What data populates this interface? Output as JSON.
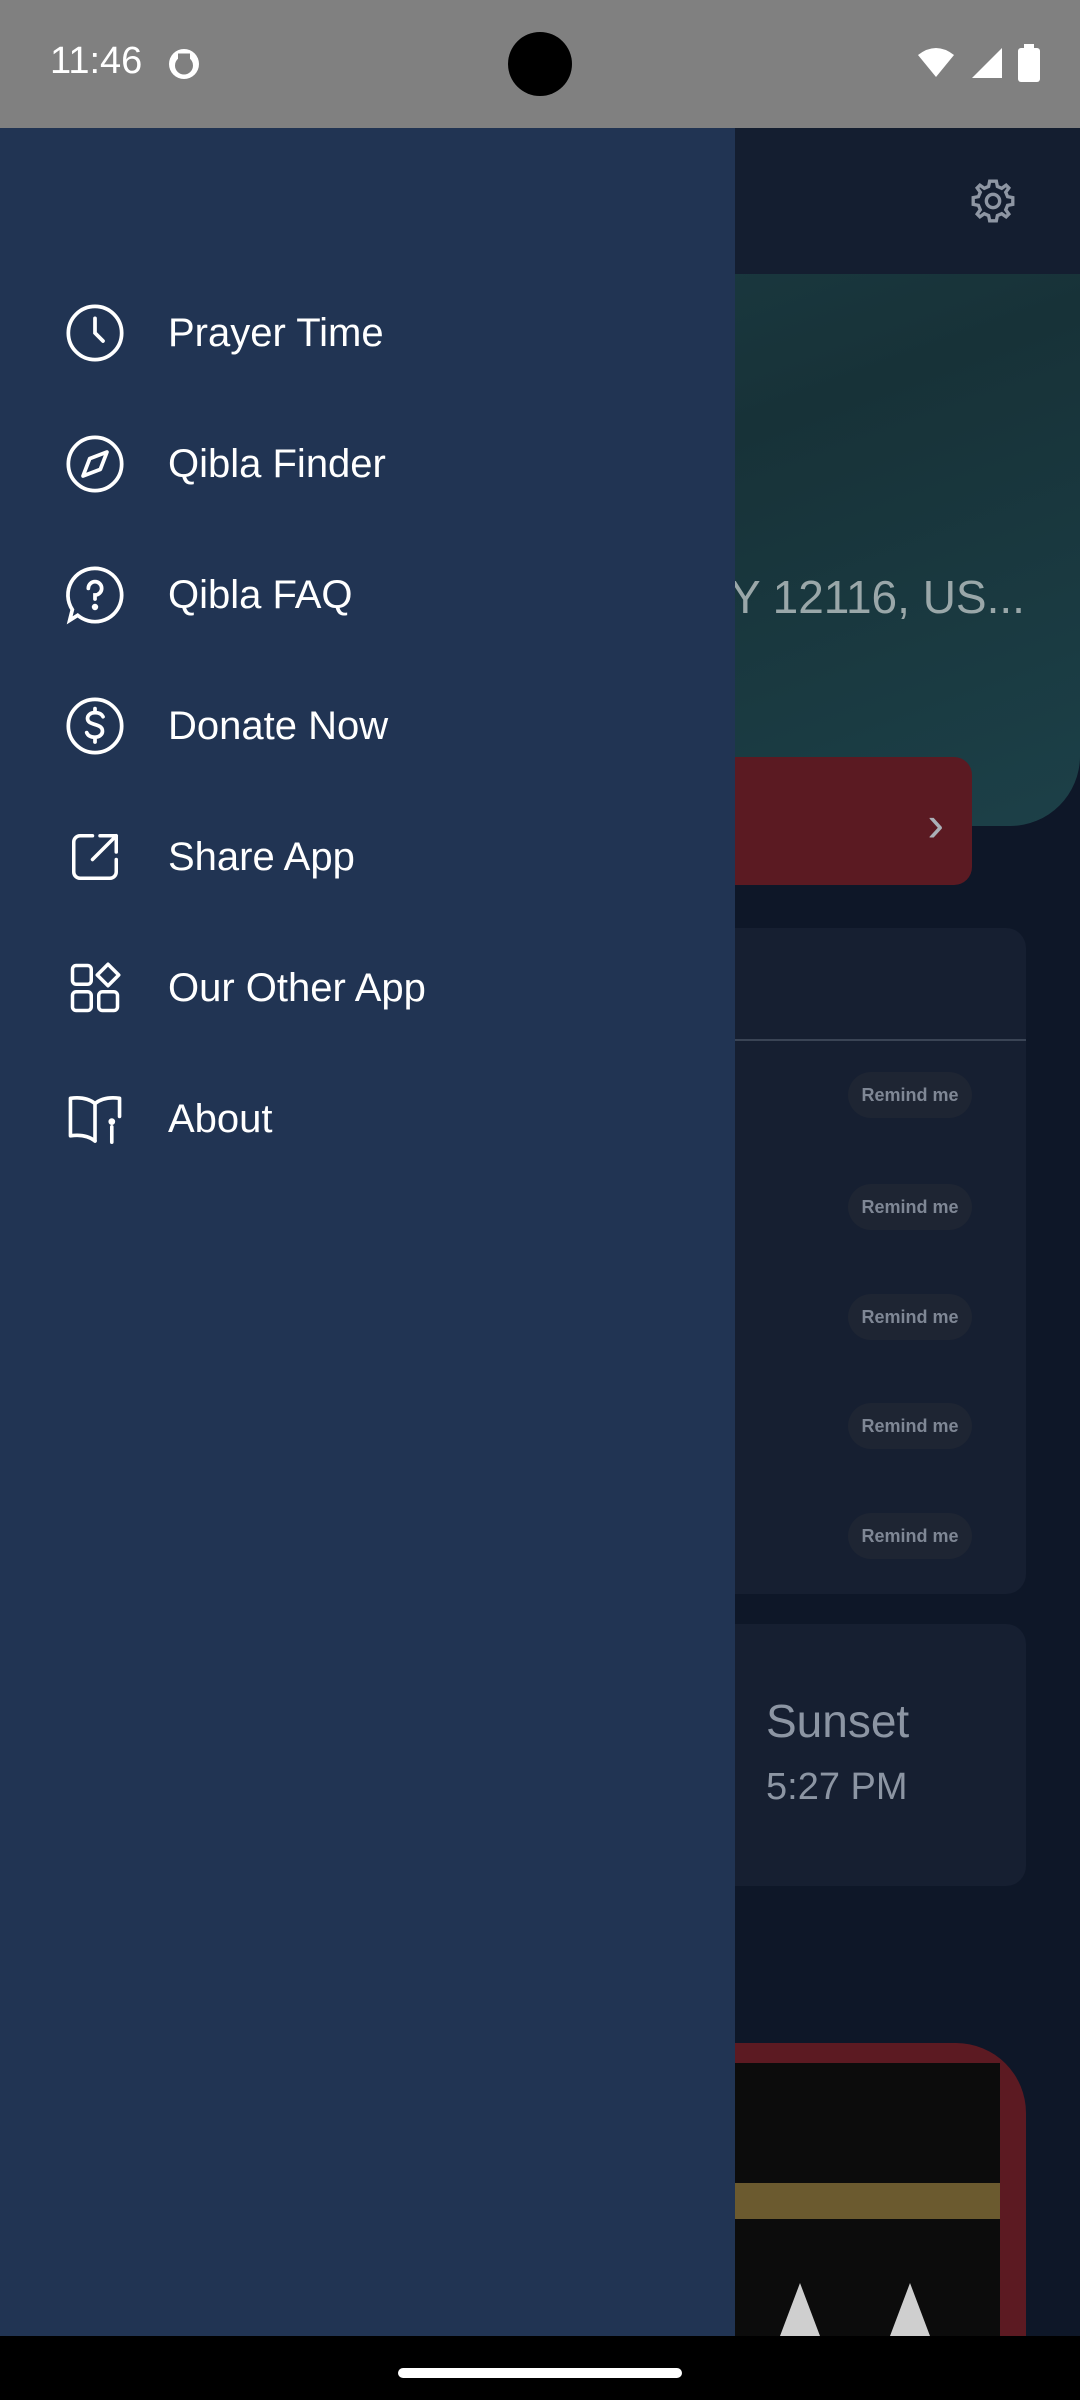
{
  "status_bar": {
    "time": "11:46"
  },
  "drawer": {
    "items": [
      {
        "label": "Prayer Time",
        "icon": "clock-icon"
      },
      {
        "label": "Qibla Finder",
        "icon": "compass-icon"
      },
      {
        "label": "Qibla FAQ",
        "icon": "help-circle-icon"
      },
      {
        "label": "Donate Now",
        "icon": "dollar-circle-icon"
      },
      {
        "label": "Share App",
        "icon": "external-link-icon"
      },
      {
        "label": "Our Other App",
        "icon": "apps-grid-icon"
      },
      {
        "label": "About",
        "icon": "book-info-icon"
      }
    ]
  },
  "background": {
    "location_fragment": "Y 12116, US...",
    "remind_label": "Remind me",
    "sunset_label": "Sunset",
    "sunset_time": "5:27 PM"
  },
  "colors": {
    "drawer_bg": "#213453",
    "accent_red": "#5b1a22",
    "status_bar": "#808080"
  }
}
